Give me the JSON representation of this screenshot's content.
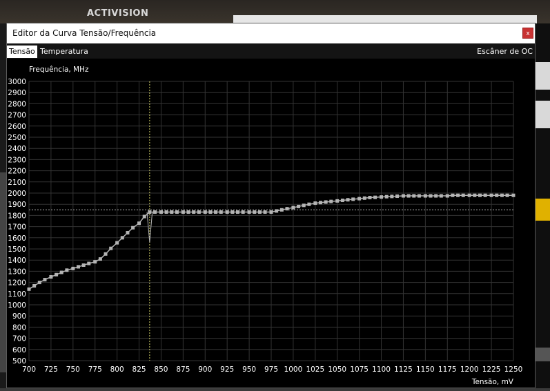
{
  "background": {
    "logo_text": "ACTIVISION"
  },
  "window": {
    "title": "Editor da Curva Tensão/Frequência",
    "close_glyph": "x",
    "tabs": [
      {
        "label": "Tensão",
        "active": true
      },
      {
        "label": "Temperatura",
        "active": false
      }
    ],
    "scanner_label": "Escâner de OC"
  },
  "colors": {
    "grid": "#333333",
    "axis_text": "#ffffff",
    "curve": "#b4b4b4",
    "guide_v": "#c8c864",
    "guide_h": "#b4b4b4"
  },
  "chart_data": {
    "type": "line",
    "ylabel": "Frequência, MHz",
    "xlabel": "Tensão, mV",
    "xlim": [
      700,
      1250
    ],
    "ylim": [
      500,
      3000
    ],
    "x_ticks": [
      700,
      725,
      750,
      775,
      800,
      825,
      850,
      875,
      900,
      925,
      950,
      975,
      1000,
      1025,
      1050,
      1075,
      1100,
      1125,
      1150,
      1175,
      1200,
      1225,
      1250
    ],
    "y_ticks": [
      500,
      600,
      700,
      800,
      900,
      1000,
      1100,
      1200,
      1300,
      1400,
      1500,
      1600,
      1700,
      1800,
      1900,
      2000,
      2100,
      2200,
      2300,
      2400,
      2500,
      2600,
      2700,
      2800,
      2900,
      3000
    ],
    "grid": true,
    "selected_voltage": 837,
    "selected_frequency": 1850,
    "series": [
      {
        "points": [
          [
            700,
            1140
          ],
          [
            706,
            1170
          ],
          [
            712,
            1200
          ],
          [
            718,
            1225
          ],
          [
            725,
            1250
          ],
          [
            731,
            1270
          ],
          [
            737,
            1290
          ],
          [
            743,
            1310
          ],
          [
            750,
            1325
          ],
          [
            756,
            1340
          ],
          [
            762,
            1355
          ],
          [
            768,
            1370
          ],
          [
            775,
            1385
          ],
          [
            781,
            1410
          ],
          [
            787,
            1455
          ],
          [
            793,
            1505
          ],
          [
            800,
            1555
          ],
          [
            806,
            1600
          ],
          [
            812,
            1645
          ],
          [
            818,
            1690
          ],
          [
            825,
            1730
          ],
          [
            831,
            1790
          ],
          [
            837,
            1830
          ],
          [
            843,
            1830
          ],
          [
            850,
            1830
          ],
          [
            856,
            1830
          ],
          [
            862,
            1830
          ],
          [
            868,
            1830
          ],
          [
            875,
            1830
          ],
          [
            881,
            1830
          ],
          [
            887,
            1830
          ],
          [
            893,
            1830
          ],
          [
            900,
            1830
          ],
          [
            906,
            1830
          ],
          [
            912,
            1830
          ],
          [
            918,
            1830
          ],
          [
            925,
            1830
          ],
          [
            931,
            1830
          ],
          [
            937,
            1830
          ],
          [
            943,
            1830
          ],
          [
            950,
            1830
          ],
          [
            956,
            1830
          ],
          [
            962,
            1830
          ],
          [
            968,
            1830
          ],
          [
            975,
            1830
          ],
          [
            981,
            1840
          ],
          [
            987,
            1850
          ],
          [
            993,
            1860
          ],
          [
            1000,
            1870
          ],
          [
            1006,
            1880
          ],
          [
            1012,
            1890
          ],
          [
            1018,
            1900
          ],
          [
            1025,
            1910
          ],
          [
            1031,
            1915
          ],
          [
            1037,
            1920
          ],
          [
            1043,
            1925
          ],
          [
            1050,
            1930
          ],
          [
            1056,
            1935
          ],
          [
            1062,
            1940
          ],
          [
            1068,
            1945
          ],
          [
            1075,
            1950
          ],
          [
            1081,
            1955
          ],
          [
            1087,
            1960
          ],
          [
            1093,
            1962
          ],
          [
            1100,
            1965
          ],
          [
            1106,
            1968
          ],
          [
            1112,
            1970
          ],
          [
            1118,
            1972
          ],
          [
            1125,
            1975
          ],
          [
            1131,
            1975
          ],
          [
            1137,
            1975
          ],
          [
            1143,
            1975
          ],
          [
            1150,
            1975
          ],
          [
            1156,
            1975
          ],
          [
            1162,
            1975
          ],
          [
            1168,
            1975
          ],
          [
            1175,
            1975
          ],
          [
            1181,
            1980
          ],
          [
            1187,
            1980
          ],
          [
            1193,
            1980
          ],
          [
            1200,
            1980
          ],
          [
            1206,
            1980
          ],
          [
            1212,
            1980
          ],
          [
            1218,
            1980
          ],
          [
            1225,
            1980
          ],
          [
            1231,
            1980
          ],
          [
            1237,
            1980
          ],
          [
            1243,
            1980
          ],
          [
            1250,
            1980
          ]
        ]
      }
    ],
    "marker_line": [
      [
        834,
        1830
      ],
      [
        837,
        1560
      ],
      [
        840,
        1830
      ]
    ]
  }
}
